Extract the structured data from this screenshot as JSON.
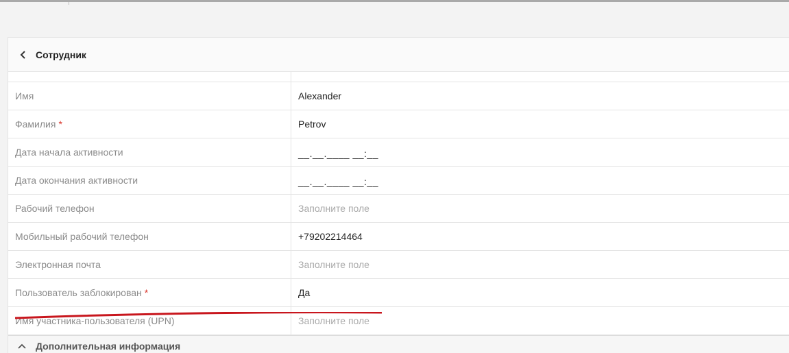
{
  "header": {
    "title": "Сотрудник",
    "back_icon": "chevron-left-icon"
  },
  "fields": [
    {
      "id": "cut-top",
      "label": "",
      "value": "",
      "partial": true
    },
    {
      "id": "first-name",
      "label": "Имя",
      "value": "Alexander",
      "required": false
    },
    {
      "id": "last-name",
      "label": "Фамилия",
      "value": "Petrov",
      "required": true,
      "required_mark": "*"
    },
    {
      "id": "active-from",
      "label": "Дата начала активности",
      "value": "__.__.____ __:__",
      "required": false
    },
    {
      "id": "active-to",
      "label": "Дата окончания активности",
      "value": "__.__.____ __:__",
      "required": false
    },
    {
      "id": "work-phone",
      "label": "Рабочий телефон",
      "placeholder": "Заполните поле",
      "required": false
    },
    {
      "id": "mobile-phone",
      "label": "Мобильный рабочий телефон",
      "value": "+79202214464",
      "required": false
    },
    {
      "id": "email",
      "label": "Электронная почта",
      "placeholder": "Заполните поле",
      "required": false
    },
    {
      "id": "blocked",
      "label": "Пользователь заблокирован",
      "value": "Да",
      "required": true,
      "required_mark": "*"
    },
    {
      "id": "upn",
      "label": "Имя участника-пользователя (UPN)",
      "placeholder": "Заполните поле",
      "required": false
    }
  ],
  "section": {
    "title": "Дополнительная информация",
    "icon": "chevron-up-icon"
  },
  "colors": {
    "required": "#d9352b",
    "annotation_stroke": "#c8161d"
  }
}
